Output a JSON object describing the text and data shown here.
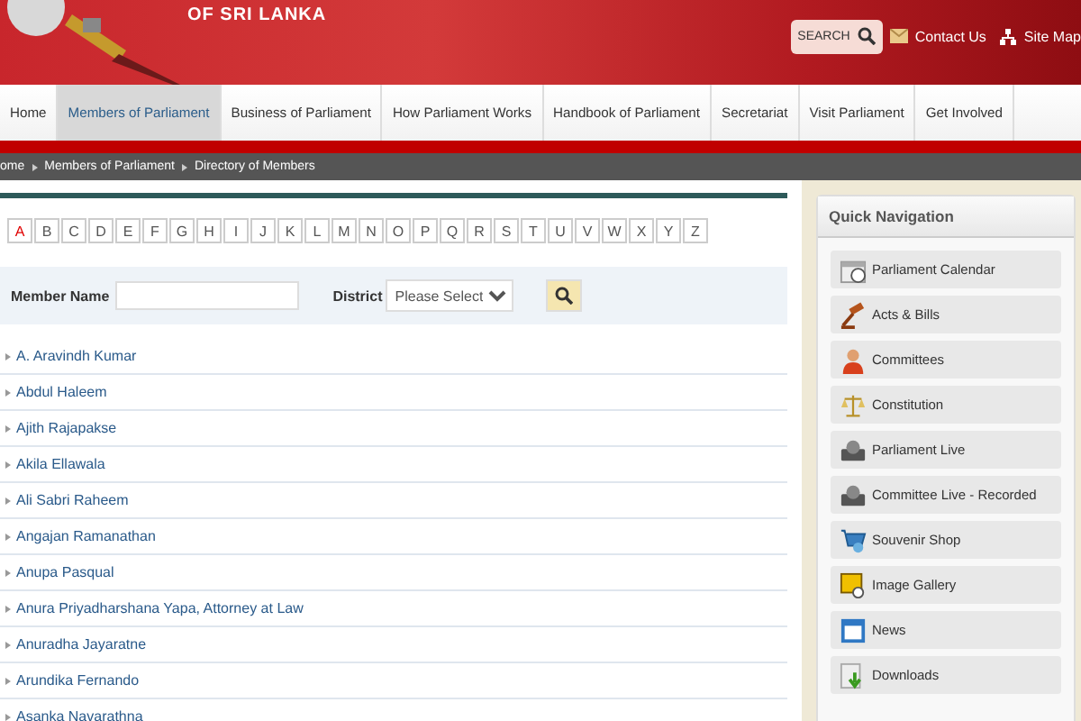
{
  "header": {
    "title": "OF SRI LANKA",
    "search_label": "SEARCH",
    "links": [
      "Contact Us",
      "Site Map"
    ]
  },
  "nav": [
    {
      "label": "Home",
      "selected": false
    },
    {
      "label": "Members of Parliament",
      "selected": true
    },
    {
      "label": "Business of Parliament",
      "selected": false
    },
    {
      "label": "How Parliament Works",
      "selected": false
    },
    {
      "label": "Handbook of Parliament",
      "selected": false
    },
    {
      "label": "Secretariat",
      "selected": false
    },
    {
      "label": "Visit Parliament",
      "selected": false
    },
    {
      "label": "Get Involved",
      "selected": false
    }
  ],
  "breadcrumb": [
    "ome",
    "Members of Parliament",
    "Directory of Members"
  ],
  "letters": [
    {
      "label": "A",
      "selected": true
    },
    {
      "label": "B",
      "selected": false
    },
    {
      "label": "C",
      "selected": false
    },
    {
      "label": "D",
      "selected": false
    },
    {
      "label": "E",
      "selected": false
    },
    {
      "label": "F",
      "selected": false
    },
    {
      "label": "G",
      "selected": false
    },
    {
      "label": "H",
      "selected": false
    },
    {
      "label": "I",
      "selected": false
    },
    {
      "label": "J",
      "selected": false
    },
    {
      "label": "K",
      "selected": false
    },
    {
      "label": "L",
      "selected": false
    },
    {
      "label": "M",
      "selected": false
    },
    {
      "label": "N",
      "selected": false
    },
    {
      "label": "O",
      "selected": false
    },
    {
      "label": "P",
      "selected": false
    },
    {
      "label": "Q",
      "selected": false
    },
    {
      "label": "R",
      "selected": false
    },
    {
      "label": "S",
      "selected": false
    },
    {
      "label": "T",
      "selected": false
    },
    {
      "label": "U",
      "selected": false
    },
    {
      "label": "V",
      "selected": false
    },
    {
      "label": "W",
      "selected": false
    },
    {
      "label": "X",
      "selected": false
    },
    {
      "label": "Y",
      "selected": false
    },
    {
      "label": "Z",
      "selected": false
    }
  ],
  "filter": {
    "member_name_label": "Member Name",
    "district_label": "District",
    "district_value": "Please Select"
  },
  "members": [
    "A. Aravindh Kumar",
    "Abdul Haleem",
    "Ajith Rajapakse",
    "Akila Ellawala",
    "Ali Sabri Raheem",
    "Angajan Ramanathan",
    "Anupa Pasqual",
    "Anura Priyadharshana Yapa, Attorney at Law",
    "Anuradha Jayaratne",
    "Arundika Fernando",
    "Asanka Navarathna"
  ],
  "quick_navigation": {
    "title": "Quick Navigation",
    "items": [
      "Parliament Calendar",
      "Acts & Bills",
      "Committees",
      "Constitution",
      "Parliament Live",
      "Committee Live - Recorded",
      "Souvenir Shop",
      "Image Gallery",
      "News",
      "Downloads"
    ]
  }
}
